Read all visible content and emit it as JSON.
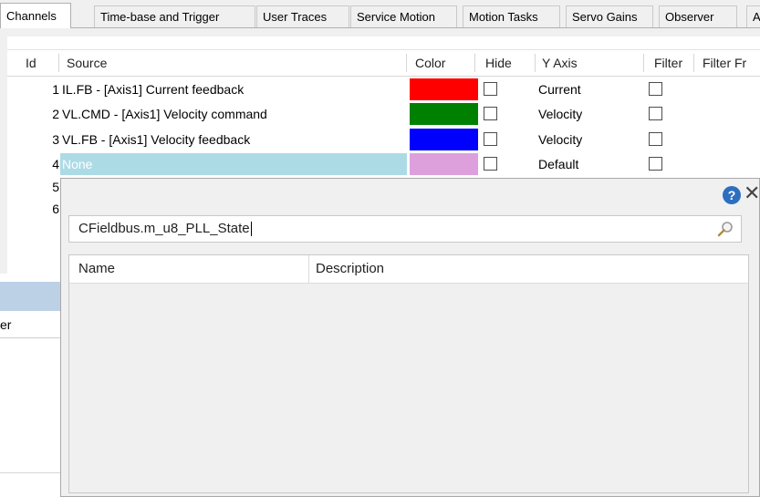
{
  "tabs": [
    {
      "label": "Channels",
      "active": true
    },
    {
      "label": "Time-base and Trigger"
    },
    {
      "label": "User Traces"
    },
    {
      "label": "Service Motion"
    },
    {
      "label": "Motion Tasks"
    },
    {
      "label": "Servo Gains"
    },
    {
      "label": "Observer"
    },
    {
      "label": "A"
    }
  ],
  "grid": {
    "headers": {
      "id": "Id",
      "source": "Source",
      "color": "Color",
      "hide": "Hide",
      "yaxis": "Y Axis",
      "filter": "Filter",
      "filter_fr": "Filter Fr"
    },
    "rows": [
      {
        "id": "1",
        "source": "IL.FB - [Axis1] Current feedback",
        "color": "#ff0000",
        "yaxis": "Current"
      },
      {
        "id": "2",
        "source": "VL.CMD - [Axis1] Velocity command",
        "color": "#008000",
        "yaxis": "Velocity"
      },
      {
        "id": "3",
        "source": "VL.FB - [Axis1] Velocity feedback",
        "color": "#0000ff",
        "yaxis": "Velocity"
      },
      {
        "id": "4",
        "source": "None",
        "color": "#dda0dd",
        "yaxis": "Default"
      },
      {
        "id": "5"
      },
      {
        "id": "6"
      }
    ]
  },
  "left_partial": {
    "text": "er"
  },
  "popup": {
    "search_value": "CFieldbus.m_u8_PLL_State",
    "help_icon": "?",
    "close_icon": "✕",
    "columns": {
      "name": "Name",
      "description": "Description"
    }
  }
}
